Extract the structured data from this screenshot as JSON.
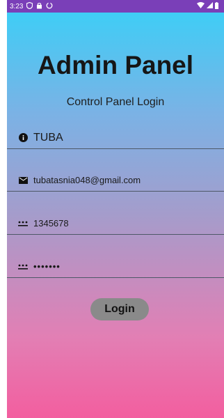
{
  "status_bar": {
    "time": "3:23",
    "background": "#7a3fb8",
    "left_icons": [
      "shield-icon",
      "lock-icon",
      "sync-icon"
    ],
    "right_icons": [
      "wifi-icon",
      "signal-icon",
      "battery-icon"
    ]
  },
  "header": {
    "title": "Admin Panel",
    "subtitle": "Control Panel Login"
  },
  "form": {
    "name": {
      "icon": "info-icon",
      "value": "TUBA"
    },
    "email": {
      "icon": "mail-icon",
      "value": "tubatasnia048@gmail.com"
    },
    "phone": {
      "icon": "password-icon",
      "value": "1345678"
    },
    "password": {
      "icon": "password-icon",
      "value": "•••••••"
    }
  },
  "login_button": {
    "label": "Login",
    "color": "#8a8a8a"
  },
  "theme": {
    "gradient_top": "#3fcdf6",
    "gradient_bottom": "#f35e9f"
  }
}
